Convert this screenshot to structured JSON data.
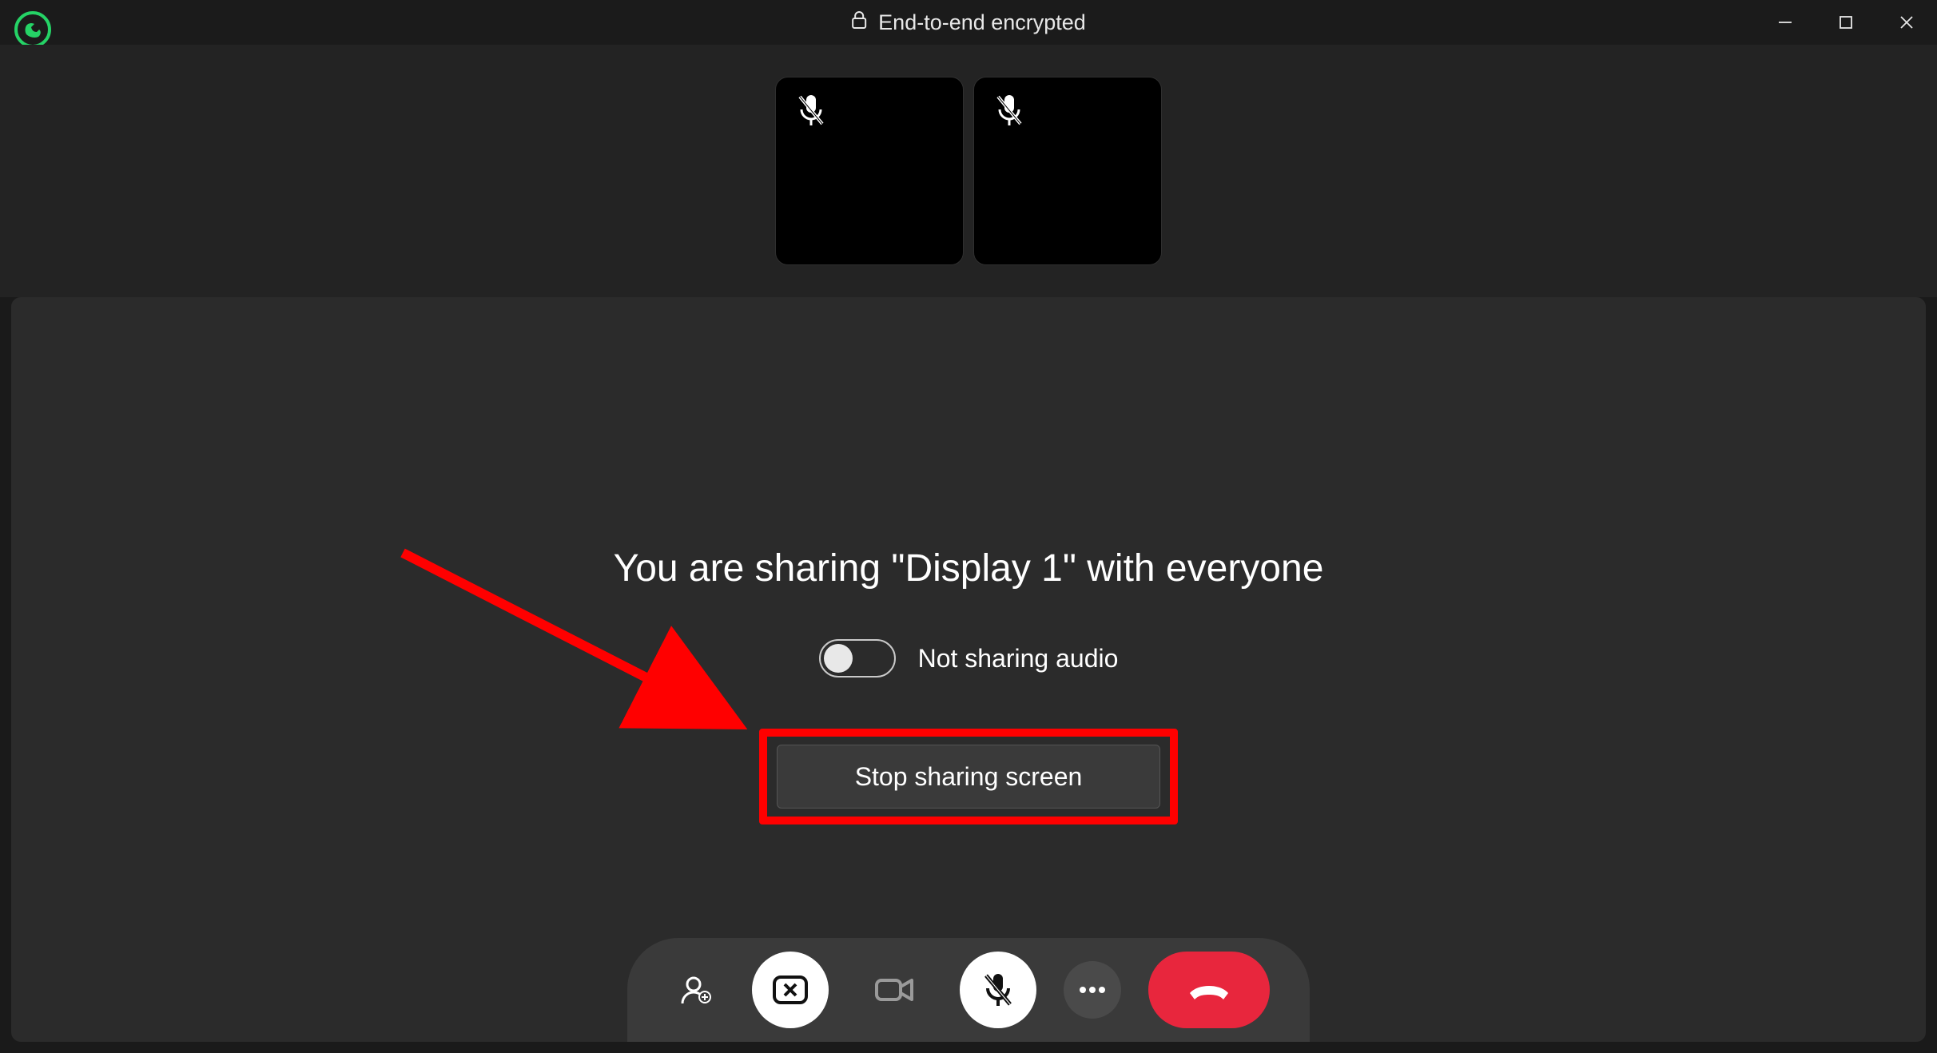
{
  "titlebar": {
    "encryption_label": "End-to-end encrypted"
  },
  "share": {
    "message": "You are sharing \"Display 1\" with everyone",
    "audio_label": "Not sharing audio",
    "stop_label": "Stop sharing screen"
  },
  "colors": {
    "whatsapp_green": "#25d366",
    "hangup_red": "#e8263d",
    "annotation_red": "#ff0000"
  }
}
